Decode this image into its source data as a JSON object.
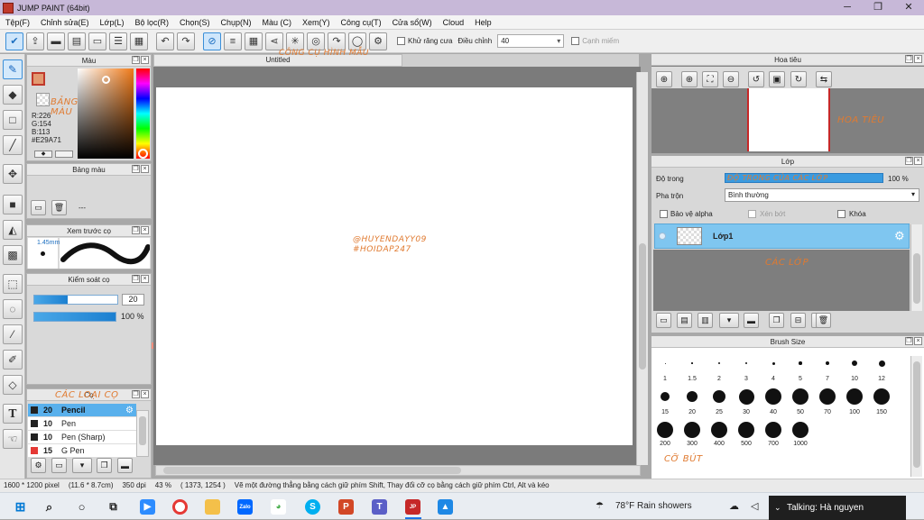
{
  "window": {
    "title": "JUMP PAINT (64bit)",
    "controls": [
      "─",
      "❐",
      "✕"
    ]
  },
  "menu": [
    "Tệp(F)",
    "Chỉnh sửa(E)",
    "Lớp(L)",
    "Bộ lọc(R)",
    "Chọn(S)",
    "Chụp(N)",
    "Màu (C)",
    "Xem(Y)",
    "Công cụ(T)",
    "Cửa sổ(W)",
    "Cloud",
    "Help"
  ],
  "toolbar": {
    "antialias_label": "Khử răng cưa",
    "adjust_label": "Điều chỉnh",
    "adjust_value": "40",
    "edge_label": "Cạnh miếm"
  },
  "annotations": {
    "shape_tools": "CÔNG CỤ HÌNH MẪU",
    "color_board": "BẢNG MÀU",
    "brush_types": "CÁC LOẠI CỌ",
    "navigator": "HOA TIÊU",
    "layer_opacity": "ĐỘ TRONG CỦA CÁC LỚP",
    "layers": "CÁC LỚP",
    "brush_sizes": "CỠ BÚT",
    "watermark1": "@HUYENDAYY09",
    "watermark2": "#HOIDAP247"
  },
  "color_panel": {
    "title": "Màu",
    "r": "R:226",
    "g": "G:154",
    "b": "B:113",
    "hex": "#E29A71",
    "color": "#e29a71"
  },
  "palette_panel": {
    "title": "Bảng màu",
    "dash": "---",
    "swatches": [
      "#f4b6c8",
      "#f7c3d6",
      "#f8d0dc",
      "#e8c6e8",
      "#f9b2d5",
      "#f28ec4",
      "#c9d8b8",
      "#a9c49a",
      "#8fae7e",
      "#ef8f7e",
      "#d86a5e",
      "#3a2f6e",
      "#b7a3d4",
      "#f2e37a",
      "#d7e6a8",
      "#f6c8b6",
      "#e8b29e"
    ]
  },
  "brush_preview": {
    "title": "Xem trước cọ",
    "size": "1.45mm"
  },
  "brush_control": {
    "title": "Kiểm soát cọ",
    "size_value": "20",
    "opacity_value": "100 %",
    "size_fraction": 0.4,
    "opacity_fraction": 1.0
  },
  "brushes": {
    "title": "Cọ",
    "items": [
      {
        "size": "20",
        "name": "Pencil",
        "color": "#222222"
      },
      {
        "size": "10",
        "name": "Pen",
        "color": "#222222"
      },
      {
        "size": "10",
        "name": "Pen (Sharp)",
        "color": "#222222"
      },
      {
        "size": "15",
        "name": "G Pen",
        "color": "#e53935"
      }
    ]
  },
  "canvas": {
    "tab": "Untitled"
  },
  "navigator_panel": {
    "title": "Hoa tiêu"
  },
  "layer_panel": {
    "title": "Lớp",
    "opacity_label": "Độ trong",
    "opacity_value": "100 %",
    "blend_label": "Pha trộn",
    "blend_value": "Bình thường",
    "protect_alpha": "Bảo vệ alpha",
    "clipping": "Xén bớt",
    "lock": "Khóa",
    "layer_name": "Lớp1"
  },
  "brush_size_panel": {
    "title": "Brush Size",
    "sizes": [
      "1",
      "1.5",
      "2",
      "3",
      "4",
      "5",
      "7",
      "10",
      "12",
      "15",
      "20",
      "25",
      "30",
      "40",
      "50",
      "70",
      "100",
      "150",
      "200",
      "300",
      "400",
      "500",
      "700",
      "1000"
    ]
  },
  "status": {
    "size": "1600 * 1200 pixel",
    "cm": "(11.6 * 8.7cm)",
    "dpi": "350 dpi",
    "zoom": "43 %",
    "coord": "( 1373, 1254 )",
    "hint": "Vẽ một đường thẳng bằng cách giữ phím Shift, Thay đổi cỡ cọ bằng cách giữ phím Ctrl, Alt và kéo"
  },
  "taskbar": {
    "weather": "78°F  Rain showers",
    "talking": "Talking: Hà nguyen"
  }
}
